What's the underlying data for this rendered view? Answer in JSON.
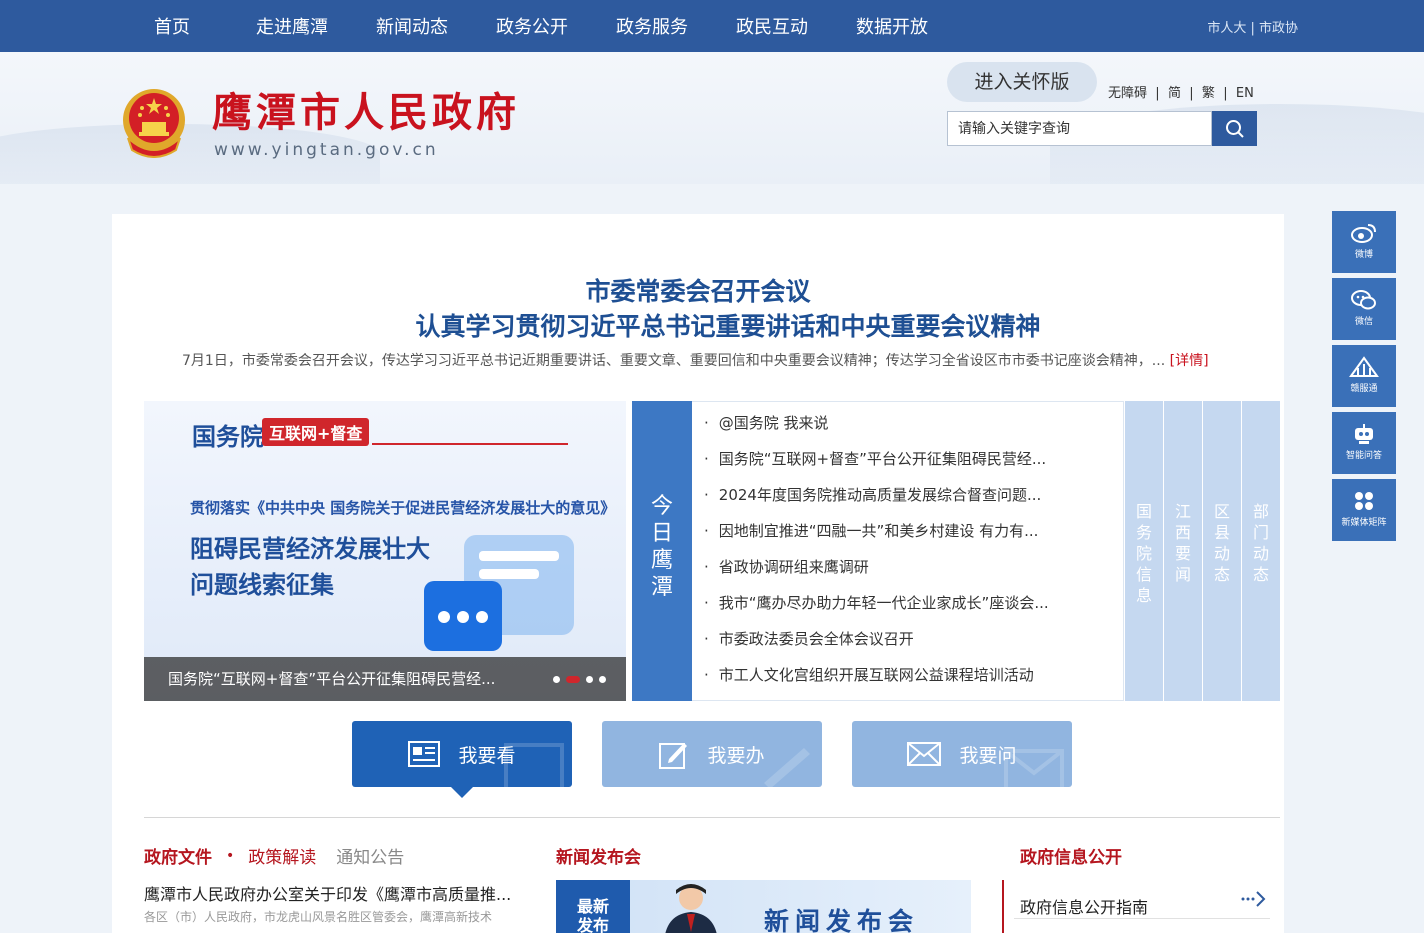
{
  "nav": {
    "items": [
      "首页",
      "走进鹰潭",
      "新闻动态",
      "政务公开",
      "政务服务",
      "政民互动",
      "数据开放"
    ],
    "links": [
      "市人大",
      "市政协"
    ]
  },
  "header": {
    "title": "鹰潭市人民政府",
    "url": "www.yingtan.gov.cn",
    "care_button": "进入关怀版",
    "lang": [
      "无障碍",
      "简",
      "繁",
      "EN"
    ],
    "search_placeholder": "请输入关键字查询"
  },
  "side": [
    {
      "label": "微博",
      "icon": "weibo-icon"
    },
    {
      "label": "微信",
      "icon": "wechat-icon"
    },
    {
      "label": "赣服通",
      "icon": "ganfutong-icon"
    },
    {
      "label": "智能问答",
      "icon": "robot-icon"
    },
    {
      "label": "新媒体矩阵",
      "icon": "matrix-icon"
    }
  ],
  "headline": {
    "line1": "市委常委会召开会议",
    "line2": "认真学习贯彻习近平总书记重要讲话和中央重要会议精神",
    "summary": "7月1日，市委常委会召开会议，传达学习习近平总书记近期重要讲话、重要文章、重要回信和中央重要会议精神；传达学习全省设区市市委书记座谈会精神，...",
    "more": "[详情]"
  },
  "banner": {
    "brand": "国务院",
    "tag": "互联网+督查",
    "subtitle": "贯彻落实《中共中央 国务院关于促进民营经济发展壮大的意见》",
    "title1": "阻碍民营经济发展壮大",
    "title2": "问题线索征集",
    "caption": "国务院“互联网+督查”平台公开征集阻碍民营经..."
  },
  "today_label": "今日鹰潭",
  "news": [
    "@国务院 我来说",
    "国务院“互联网+督查”平台公开征集阻碍民营经...",
    "2024年度国务院推动高质量发展综合督查问题...",
    "因地制宜推进“四融一共”和美乡村建设 有力有...",
    "省政协调研组来鹰调研",
    "我市“鹰办尽办助力年轻一代企业家成长”座谈会...",
    "市委政法委员会全体会议召开",
    "市工人文化宫组织开展互联网公益课程培训活动"
  ],
  "vtabs": [
    "国务院信息",
    "江西要闻",
    "区县动态",
    "部门动态"
  ],
  "actions": [
    "我要看",
    "我要办",
    "我要问"
  ],
  "docs": {
    "tabs": [
      "政府文件",
      "政策解读",
      "通知公告"
    ],
    "title": "鹰潭市人民政府办公室关于印发《鹰潭市高质量推...",
    "desc": "各区（市）人民政府，市龙虎山风景名胜区管委会，鹰潭高新技术"
  },
  "press": {
    "title": "新闻发布会",
    "badge": "最新发布",
    "banner_text": "新闻发布会"
  },
  "info": {
    "title": "政府信息公开",
    "item": "政府信息公开指南"
  }
}
